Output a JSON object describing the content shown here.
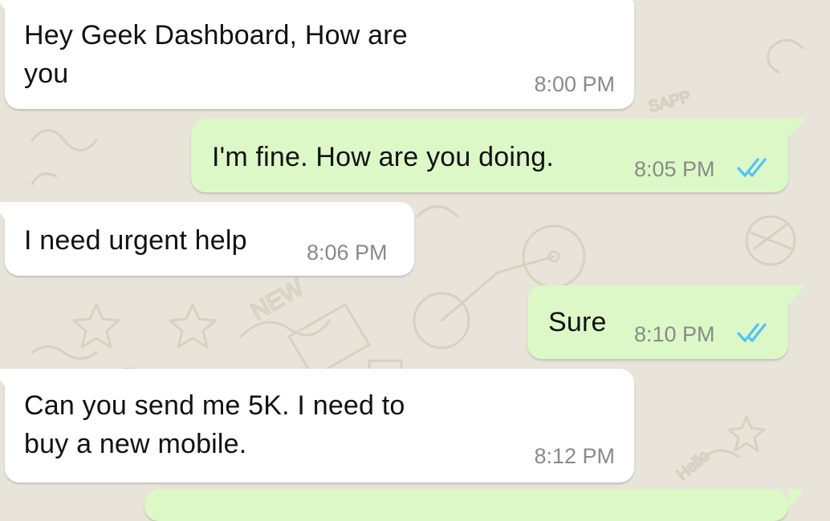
{
  "chat": {
    "messages": [
      {
        "direction": "incoming",
        "text": "Hey Geek Dashboard, How are\nyou",
        "time": "8:00 PM"
      },
      {
        "direction": "outgoing",
        "text": "I'm fine. How are you doing.",
        "time": "8:05 PM",
        "status": "read-double-check-icon"
      },
      {
        "direction": "incoming",
        "text": "I need urgent help",
        "time": "8:06 PM"
      },
      {
        "direction": "outgoing",
        "text": "Sure",
        "time": "8:10 PM",
        "status": "read-double-check-icon"
      },
      {
        "direction": "incoming",
        "text": "Can you send me 5K. I need to\nbuy a new mobile.",
        "time": "8:12 PM"
      }
    ]
  },
  "colors": {
    "incoming_bubble": "#ffffff",
    "outgoing_bubble": "#dcf8c6",
    "wallpaper": "#e8e4da",
    "read_ticks": "#4fc3f7",
    "timestamp": "#8a8a8a"
  }
}
